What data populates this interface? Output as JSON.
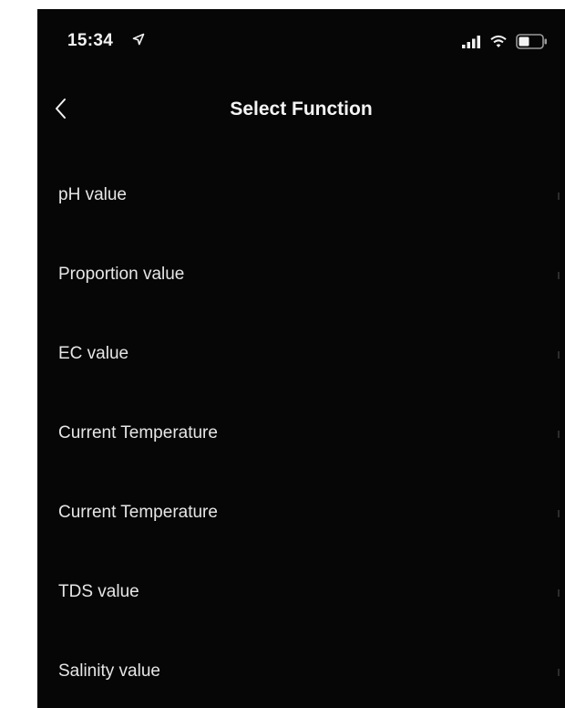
{
  "status_bar": {
    "time": "15:34"
  },
  "header": {
    "title": "Select Function"
  },
  "functions": [
    {
      "label": "pH value"
    },
    {
      "label": "Proportion value"
    },
    {
      "label": "EC value"
    },
    {
      "label": "Current Temperature"
    },
    {
      "label": "Current Temperature"
    },
    {
      "label": "TDS value"
    },
    {
      "label": "Salinity value"
    }
  ],
  "icons": {
    "location": "location-arrow-icon",
    "signal": "cellular-signal-icon",
    "wifi": "wifi-icon",
    "battery": "battery-icon",
    "back": "chevron-left-icon"
  },
  "colors": {
    "background": "#060606",
    "text": "#f2f2f2"
  }
}
